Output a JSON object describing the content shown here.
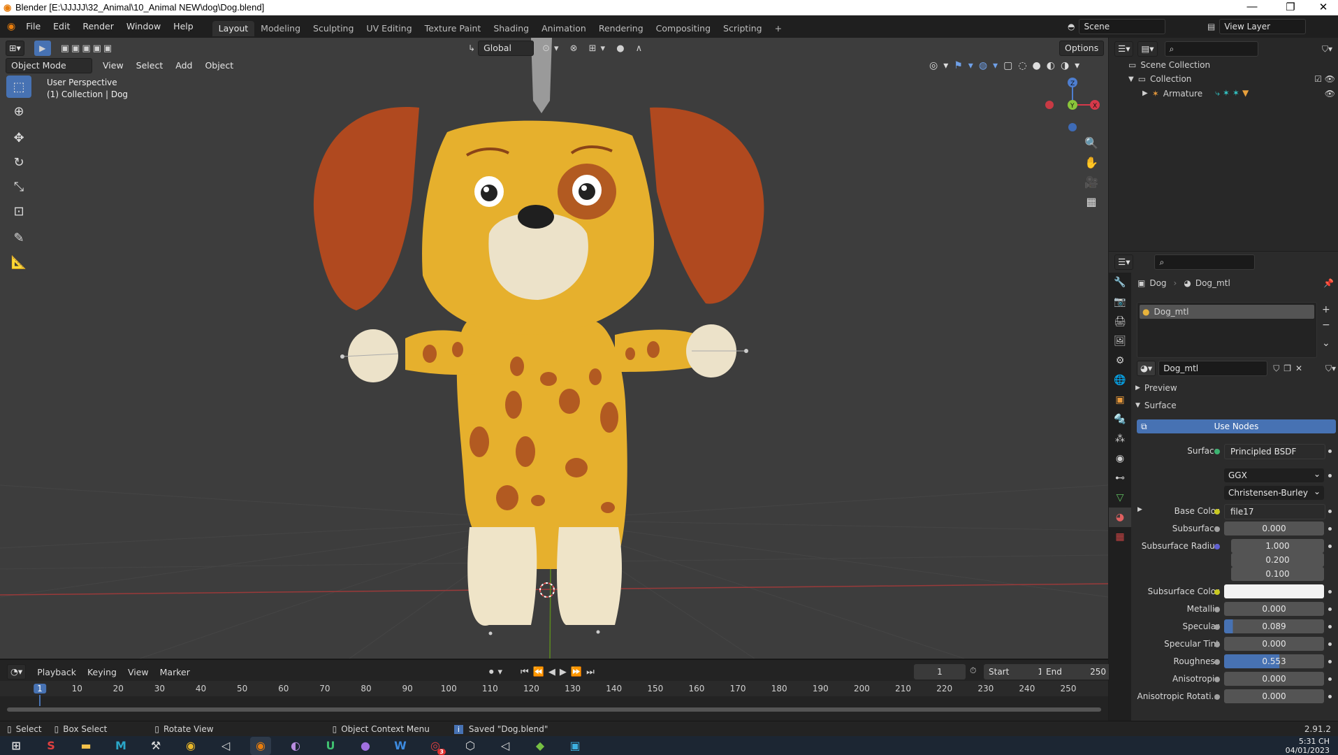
{
  "titlebar": {
    "title": "Blender [E:\\JJJJJ\\32_Animal\\10_Animal NEW\\dog\\Dog.blend]",
    "minimize": "—",
    "restore": "❐",
    "close": "✕"
  },
  "menubar": {
    "menus": [
      "File",
      "Edit",
      "Render",
      "Window",
      "Help"
    ],
    "workspaces": [
      "Layout",
      "Modeling",
      "Sculpting",
      "UV Editing",
      "Texture Paint",
      "Shading",
      "Animation",
      "Rendering",
      "Compositing",
      "Scripting"
    ],
    "active_workspace": "Layout",
    "add_tab": "+",
    "scene": "Scene",
    "view_layer": "View Layer"
  },
  "viewport": {
    "transform_orientation": "Global",
    "options": "Options",
    "mode": "Object Mode",
    "menus": [
      "View",
      "Select",
      "Add",
      "Object"
    ],
    "overlay_line1": "User Perspective",
    "overlay_line2": "(1) Collection | Dog",
    "gizmo": {
      "z": "Z",
      "y": "Y",
      "x": "X"
    }
  },
  "timeline": {
    "menus": [
      "Playback",
      "Keying",
      "View",
      "Marker"
    ],
    "current_frame": "1",
    "start_label": "Start",
    "start": "1",
    "end_label": "End",
    "end": "250",
    "ruler": [
      "1",
      "10",
      "20",
      "30",
      "40",
      "50",
      "60",
      "70",
      "80",
      "90",
      "100",
      "110",
      "120",
      "130",
      "140",
      "150",
      "160",
      "170",
      "180",
      "190",
      "200",
      "210",
      "220",
      "230",
      "240",
      "250"
    ]
  },
  "outliner": {
    "items": [
      {
        "label": "Scene Collection"
      },
      {
        "label": "Collection"
      },
      {
        "label": "Armature"
      }
    ]
  },
  "properties": {
    "breadcrumb_object": "Dog",
    "breadcrumb_material": "Dog_mtl",
    "slot": "Dog_mtl",
    "material_name": "Dog_mtl",
    "preview": "Preview",
    "surface_panel": "Surface",
    "use_nodes": "Use Nodes",
    "rows": [
      {
        "label": "Surface",
        "value": "Principled BSDF",
        "dot": "#3cb371"
      },
      {
        "label": "",
        "value": "GGX",
        "dot": ""
      },
      {
        "label": "",
        "value": "Christensen-Burley",
        "dot": ""
      },
      {
        "label": "Base Color",
        "value": "file17",
        "dot": "#c8c820"
      },
      {
        "label": "Subsurface",
        "value": "0.000",
        "dot": "#a0a0a0"
      },
      {
        "label": "Subsurface Radius",
        "value": "1.000",
        "dot": "#6060d0"
      },
      {
        "label": "",
        "value": "0.200",
        "dot": ""
      },
      {
        "label": "",
        "value": "0.100",
        "dot": ""
      },
      {
        "label": "Subsurface Color",
        "value": "",
        "dot": "#c8c820"
      },
      {
        "label": "Metallic",
        "value": "0.000",
        "dot": "#a0a0a0"
      },
      {
        "label": "Specular",
        "value": "0.089",
        "dot": "#a0a0a0"
      },
      {
        "label": "Specular Tint",
        "value": "0.000",
        "dot": "#a0a0a0"
      },
      {
        "label": "Roughness",
        "value": "0.553",
        "dot": "#a0a0a0"
      },
      {
        "label": "Anisotropic",
        "value": "0.000",
        "dot": "#a0a0a0"
      },
      {
        "label": "Anisotropic Rotati...",
        "value": "0.000",
        "dot": "#a0a0a0"
      }
    ]
  },
  "statusbar": {
    "select": "Select",
    "box_select": "Box Select",
    "rotate_view": "Rotate View",
    "context_menu": "Object Context Menu",
    "message": "Saved \"Dog.blend\"",
    "version": "2.91.2"
  },
  "taskbar": {
    "time": "5:31 CH",
    "date": "04/01/2023",
    "badge": "3"
  }
}
